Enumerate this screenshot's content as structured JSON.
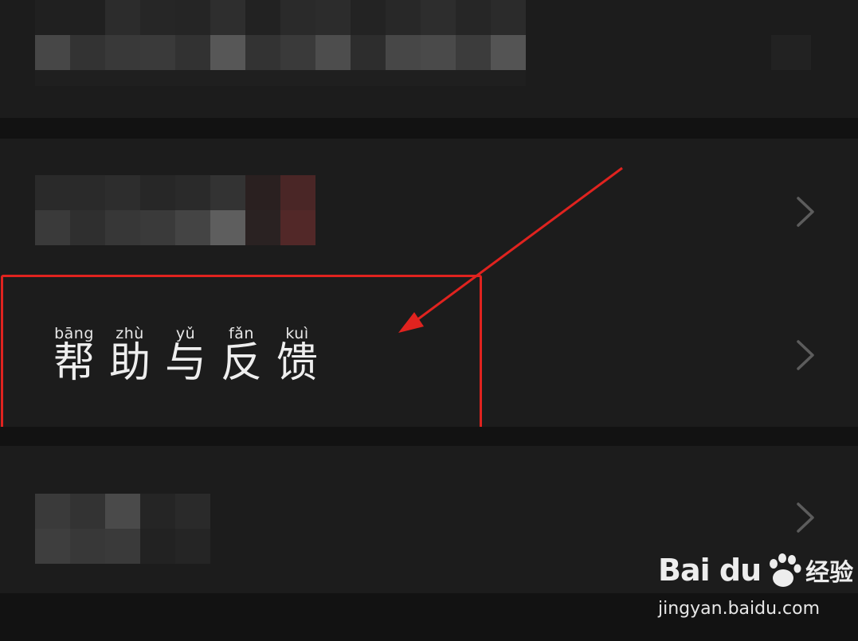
{
  "menu": {
    "items": [
      {
        "label": "(blurred)",
        "has_chevron": false
      },
      {
        "label": "(blurred)",
        "has_chevron": true
      },
      {
        "label": "帮助与反馈",
        "has_chevron": true,
        "highlighted": true
      },
      {
        "label": "(blurred)",
        "has_chevron": true
      }
    ]
  },
  "help_feedback": {
    "pinyin": [
      "bāng",
      "zhù",
      "yǔ",
      "fǎn",
      "kuì"
    ],
    "chars": [
      "帮",
      "助",
      "与",
      "反",
      "馈"
    ]
  },
  "annotation": {
    "highlight_color": "#e0231f",
    "arrow_color": "#e0231f"
  },
  "watermark": {
    "brand": "Bai du",
    "brand_suffix": "经验",
    "url": "jingyan.baidu.com"
  },
  "icons": [
    "chevron-right-icon",
    "baidu-paw-icon"
  ]
}
